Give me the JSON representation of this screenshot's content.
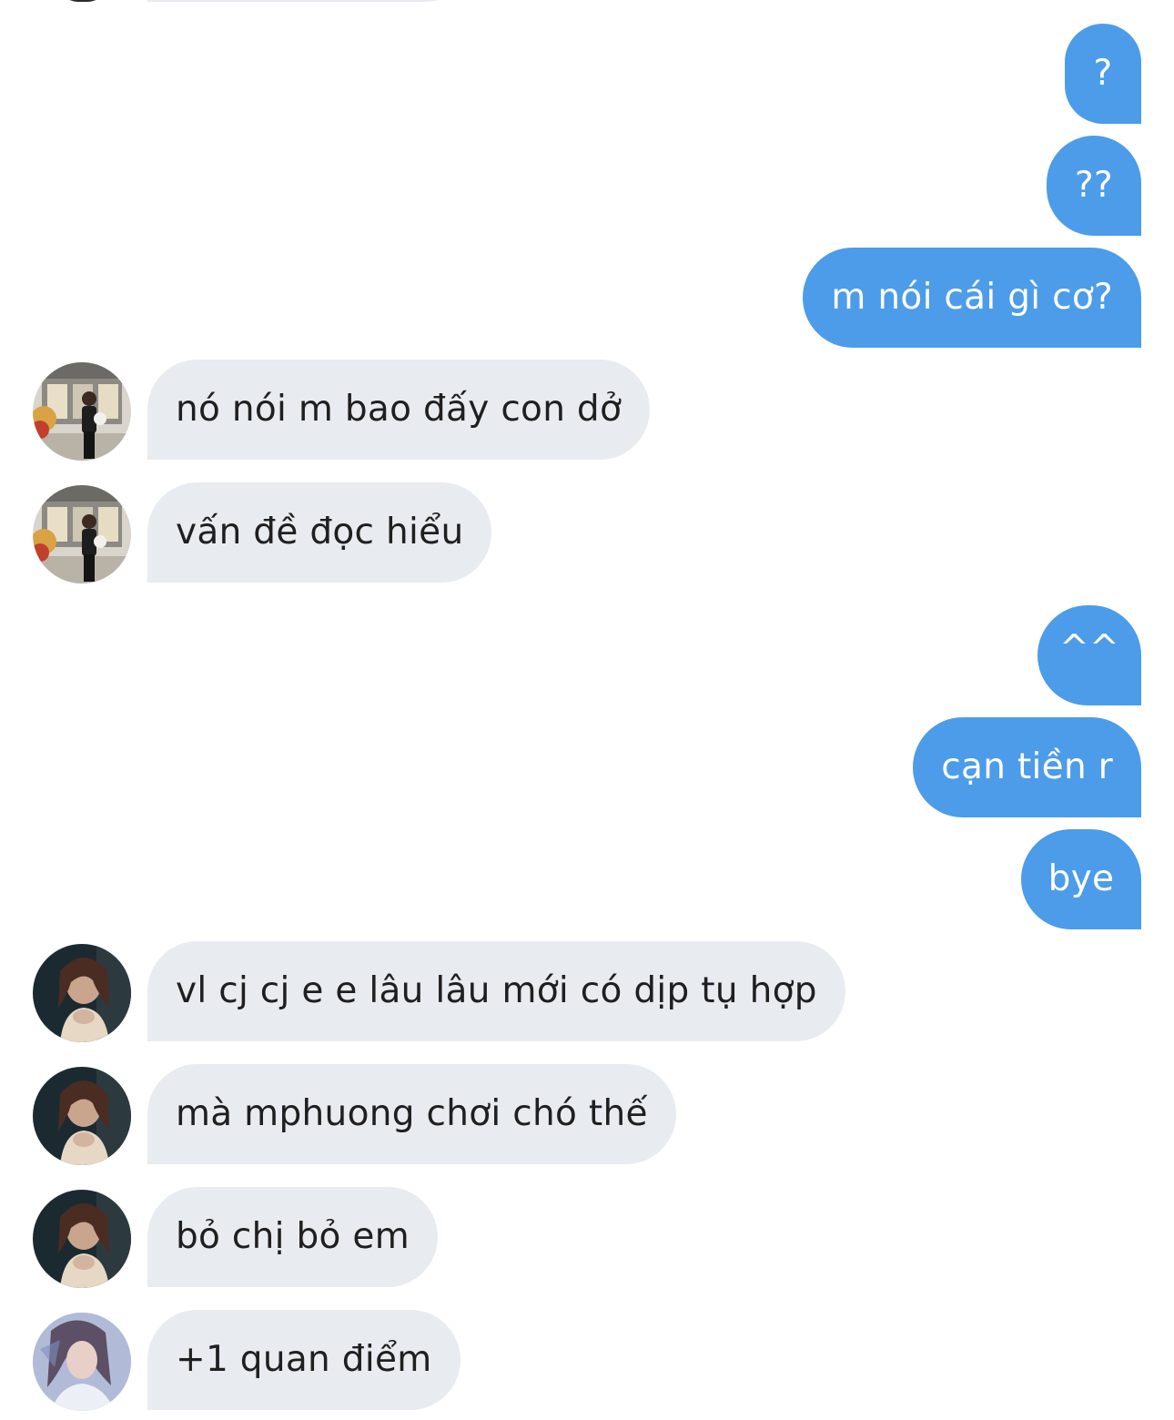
{
  "colors": {
    "outgoing_bubble": "#4c9ce9",
    "incoming_bubble": "#e8ebf0",
    "incoming_text": "#1f1f1f",
    "outgoing_text": "#ffffff"
  },
  "messages": [
    {
      "dir": "out",
      "text": "?"
    },
    {
      "dir": "out",
      "text": "??"
    },
    {
      "dir": "out",
      "text": "m nói cái gì cơ?"
    },
    {
      "dir": "in",
      "avatar": "avatar-user-a",
      "text": "nó nói m bao đấy con dở"
    },
    {
      "dir": "in",
      "avatar": "avatar-user-a",
      "text": "vấn đề đọc hiểu"
    },
    {
      "dir": "out",
      "text": "^^"
    },
    {
      "dir": "out",
      "text": "cạn tiền r"
    },
    {
      "dir": "out",
      "text": "bye"
    },
    {
      "dir": "in",
      "avatar": "avatar-user-b",
      "text": "vl cj cj e e lâu lâu mới có dịp tụ hợp"
    },
    {
      "dir": "in",
      "avatar": "avatar-user-b",
      "text": "mà mphuong chơi chó thế"
    },
    {
      "dir": "in",
      "avatar": "avatar-user-b",
      "text": "bỏ chị bỏ em"
    },
    {
      "dir": "in",
      "avatar": "avatar-user-c",
      "text": "+1 quan điểm"
    }
  ]
}
